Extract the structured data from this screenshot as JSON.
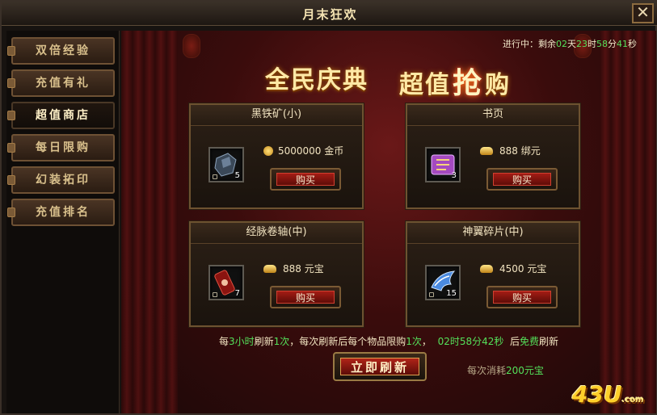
{
  "window": {
    "title": "月末狂欢"
  },
  "sidebar": {
    "tabs": [
      {
        "label": "双倍经验"
      },
      {
        "label": "充值有礼"
      },
      {
        "label": "超值商店"
      },
      {
        "label": "每日限购"
      },
      {
        "label": "幻装拓印"
      },
      {
        "label": "充值排名"
      }
    ],
    "active": "超值商店"
  },
  "timer": {
    "prefix": "进行中：剩余",
    "days": "02",
    "days_unit": "天",
    "hours": "23",
    "hours_unit": "时",
    "minutes": "58",
    "minutes_unit": "分",
    "seconds": "41",
    "seconds_unit": "秒"
  },
  "banner": {
    "left": "全民庆典",
    "right_a": "超值",
    "right_hl": "抢",
    "right_b": "购"
  },
  "items": [
    {
      "name": "黑铁矿(小)",
      "count": "5",
      "price": "5000000",
      "currency": "金币",
      "currency_icon": "gold-coin-icon",
      "buy_label": "购买",
      "icon": "ore-icon"
    },
    {
      "name": "书页",
      "count": "3",
      "price": "888",
      "currency": "绑元",
      "currency_icon": "bound-ingot-icon",
      "buy_label": "购买",
      "icon": "scroll-page-icon"
    },
    {
      "name": "经脉卷轴(中)",
      "count": "7",
      "price": "888",
      "currency": "元宝",
      "currency_icon": "ingot-icon",
      "buy_label": "购买",
      "icon": "meridian-scroll-icon"
    },
    {
      "name": "神翼碎片(中)",
      "count": "15",
      "price": "4500",
      "currency": "元宝",
      "currency_icon": "ingot-icon",
      "buy_label": "购买",
      "icon": "wing-fragment-icon"
    }
  ],
  "refresh": {
    "p1": "每",
    "interval": "3小时",
    "p2": "刷新",
    "times": "1次",
    "p3": "，每次刷新后每个物品限购",
    "limit": "1次",
    "p4": "，",
    "countdown": "02时58分42秒",
    "p5": "后",
    "free": "免费",
    "p6": "刷新",
    "button_label": "立即刷新",
    "cost_prefix": "每次消耗",
    "cost_value": "200元宝"
  },
  "logo": {
    "main": "43U",
    "sub": ".com"
  },
  "colors": {
    "accent_green": "#54e05a",
    "button_red": "#a41c14",
    "gold": "#ffcf2a"
  }
}
